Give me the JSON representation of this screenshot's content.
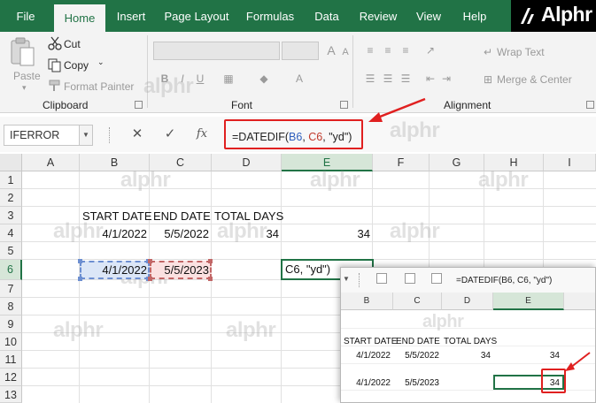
{
  "tabs": [
    {
      "label": "File",
      "active": false
    },
    {
      "label": "Home",
      "active": true
    },
    {
      "label": "Insert",
      "active": false
    },
    {
      "label": "Page Layout",
      "active": false
    },
    {
      "label": "Formulas",
      "active": false
    },
    {
      "label": "Data",
      "active": false
    },
    {
      "label": "Review",
      "active": false
    },
    {
      "label": "View",
      "active": false
    },
    {
      "label": "Help",
      "active": false
    }
  ],
  "brand": {
    "name": "Alphr"
  },
  "ribbon": {
    "clipboard": {
      "paste": "Paste",
      "cut": "Cut",
      "copy": "Copy",
      "format_painter": "Format Painter",
      "label": "Clipboard"
    },
    "font": {
      "label": "Font"
    },
    "alignment": {
      "wrap_text": "Wrap Text",
      "merge_center": "Merge & Center",
      "label": "Alignment"
    }
  },
  "formula_bar": {
    "name_box": "IFERROR",
    "cancel": "✕",
    "enter": "✓",
    "fx": "fx",
    "formula_parts": [
      "=DATEDIF(",
      "B6",
      ", ",
      "C6",
      ", \"yd\")"
    ]
  },
  "columns": [
    "A",
    "B",
    "C",
    "D",
    "E",
    "F",
    "G",
    "H",
    "I"
  ],
  "rows": [
    "1",
    "2",
    "3",
    "4",
    "5",
    "6",
    "7",
    "8",
    "9",
    "10",
    "11",
    "12",
    "13"
  ],
  "cells": {
    "b3": "START DATE",
    "c3": "END DATE",
    "d3": "TOTAL DAYS",
    "b4": "4/1/2022",
    "c4": "5/5/2022",
    "d4": "34",
    "e4": "34",
    "b6": "4/1/2022",
    "c6": "5/5/2023",
    "e6_edit": "C6, \"yd\")"
  },
  "inset": {
    "formula": "=DATEDIF(B6, C6, \"yd\")",
    "columns": [
      "B",
      "C",
      "D",
      "E"
    ],
    "start_date": "START DATE",
    "end_date": "END DATE",
    "total_days": "TOTAL DAYS",
    "row11": {
      "b": "4/1/2022",
      "c": "5/5/2022",
      "d": "34",
      "e": "34"
    },
    "row12": {
      "b": "4/1/2022",
      "c": "5/5/2023",
      "e": "34"
    }
  },
  "watermark": "alphr",
  "colors": {
    "excel_green": "#217346",
    "highlight_red": "#e02020"
  }
}
